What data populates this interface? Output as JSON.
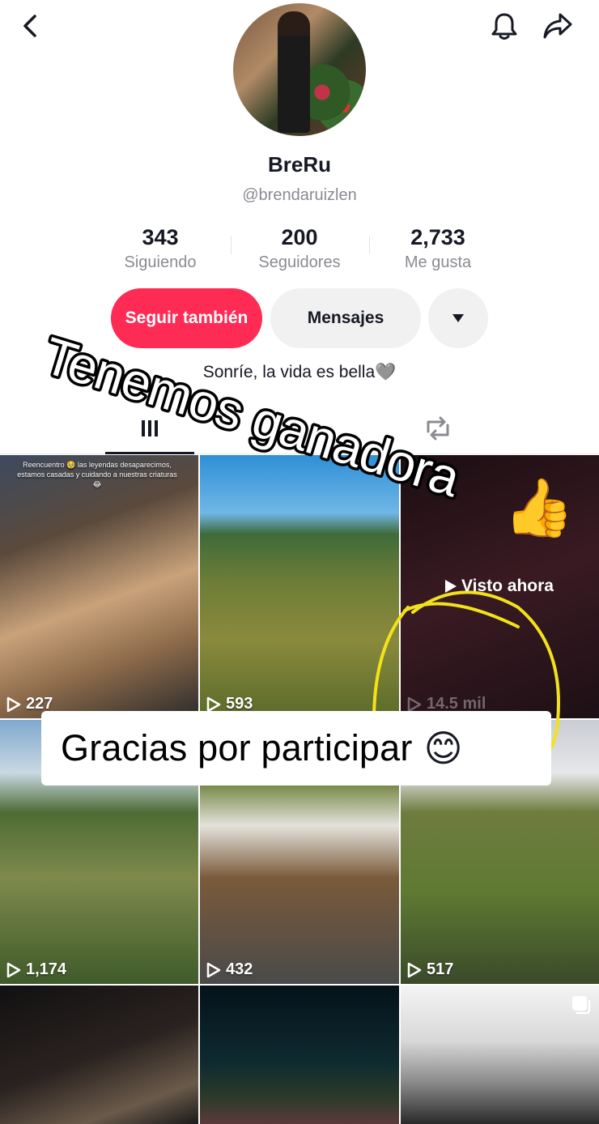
{
  "header": {
    "back_icon": "chevron-left-icon",
    "bell_icon": "bell-icon",
    "share_icon": "share-arrow-icon"
  },
  "profile": {
    "name": "BreRu",
    "handle": "@brendaruizlen",
    "bio": "Sonríe, la vida es bella🩶",
    "stats": [
      {
        "value": "343",
        "label": "Siguiendo"
      },
      {
        "value": "200",
        "label": "Seguidores"
      },
      {
        "value": "2,733",
        "label": "Me gusta"
      }
    ]
  },
  "actions": {
    "follow_label": "Seguir también",
    "message_label": "Mensajes",
    "more_icon": "caret-down-icon"
  },
  "tabs": [
    {
      "name": "videos",
      "icon": "grid-icon"
    },
    {
      "name": "reposts",
      "icon": "repost-icon"
    }
  ],
  "overlays": {
    "title": "Tenemos ganadora",
    "thumb_emoji": "👍",
    "banner": "Gracias por participar",
    "banner_emoji": "😊",
    "visto": "Visto ahora"
  },
  "videos": [
    {
      "views": "227",
      "caption": "Reencuentro 🥹 las leyendas desaparecimos, estamos casadas y cuidando a nuestras criaturas 😂"
    },
    {
      "views": "593"
    },
    {
      "views": "14.5 mil"
    },
    {
      "views": "1,174"
    },
    {
      "views": "432"
    },
    {
      "views": "517"
    },
    {
      "views": ""
    },
    {
      "views": ""
    },
    {
      "views": ""
    }
  ],
  "colors": {
    "accent": "#fe2c55",
    "highlight": "#f2e21b",
    "muted": "#8a8b91"
  }
}
